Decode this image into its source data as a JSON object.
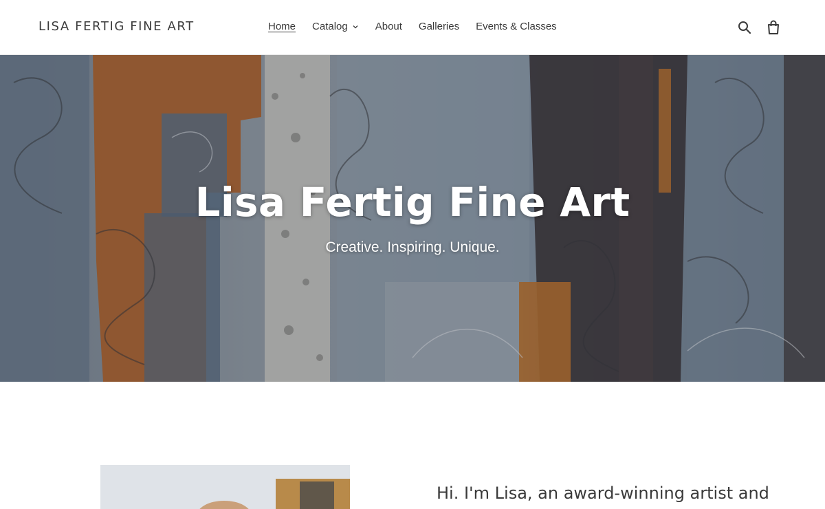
{
  "header": {
    "logo": "LISA FERTIG FINE ART",
    "nav": [
      {
        "label": "Home",
        "active": true
      },
      {
        "label": "Catalog",
        "has_dropdown": true
      },
      {
        "label": "About"
      },
      {
        "label": "Galleries"
      },
      {
        "label": "Events & Classes"
      }
    ],
    "icons": [
      "search-icon",
      "cart-icon"
    ]
  },
  "hero": {
    "title": "Lisa Fertig Fine Art",
    "subtitle": "Creative. Inspiring. Unique."
  },
  "intro": {
    "text": "Hi. I'm Lisa, an award-winning artist and art instructor who is inspired ..."
  },
  "colors": {
    "text": "#3a3a3a",
    "hero_blue": "#7f90a1",
    "hero_orange": "#b8682a",
    "hero_dark": "#3b3538"
  }
}
